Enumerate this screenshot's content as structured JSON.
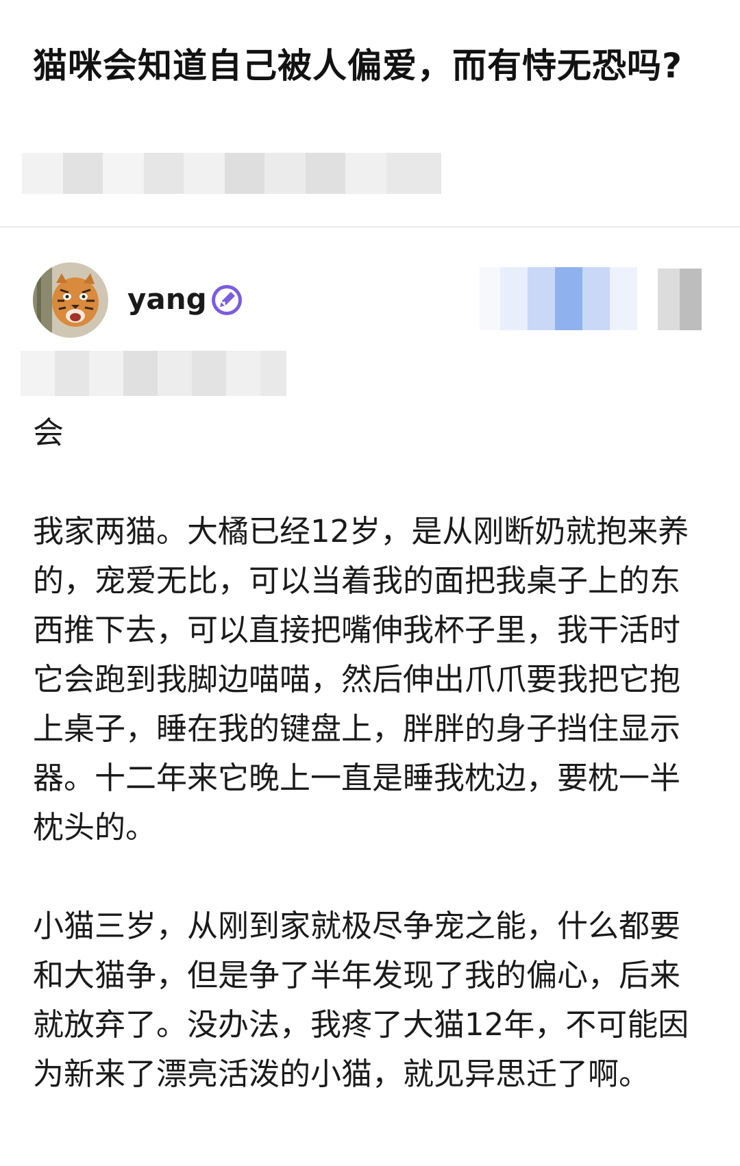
{
  "question": {
    "title": "猫咪会知道自己被人偏爱，而有恃无恐吗?"
  },
  "answer": {
    "author": {
      "name": "yang",
      "avatar_icon": "tiger-avatar",
      "badge_icon": "pen-nib-icon",
      "badge_color": "#7b5ce0"
    },
    "paragraphs": [
      "会",
      "我家两猫。大橘已经12岁，是从刚断奶就抱来养的，宠爱无比，可以当着我的面把我桌子上的东西推下去，可以直接把嘴伸我杯子里，我干活时它会跑到我脚边喵喵，然后伸出爪爪要我把它抱上桌子，睡在我的键盘上，胖胖的身子挡住显示器。十二年来它晚上一直是睡我枕边，要枕一半枕头的。",
      "小猫三岁，从刚到家就极尽争宠之能，什么都要和大猫争，但是争了半年发现了我的偏心，后来就放弃了。没办法，我疼了大猫12年，不可能因为新来了漂亮活泼的小猫，就见异思迁了啊。"
    ]
  }
}
